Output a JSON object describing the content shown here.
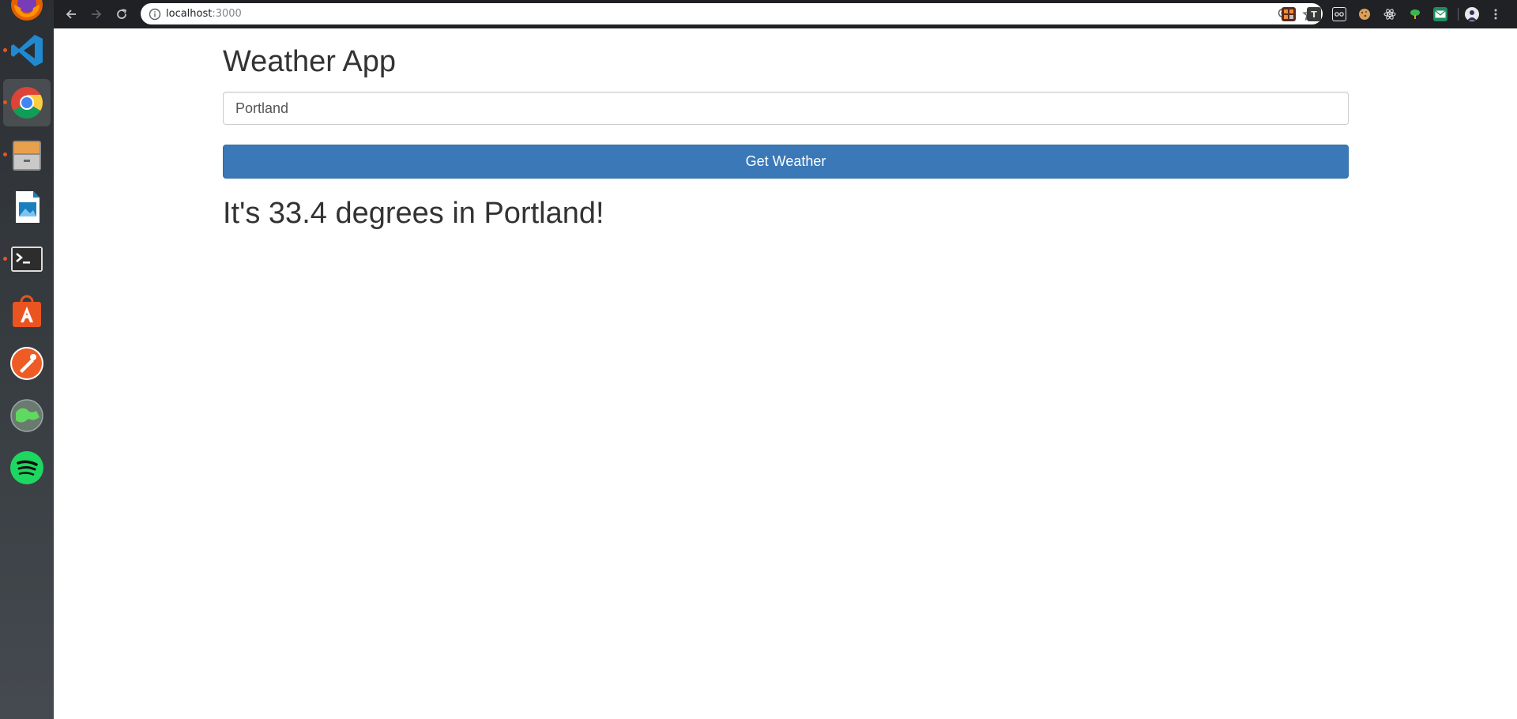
{
  "browser": {
    "url_host": "localhost",
    "url_port": ":3000"
  },
  "dock": {
    "apps": [
      {
        "name": "firefox-icon"
      },
      {
        "name": "vscode-icon"
      },
      {
        "name": "chrome-icon"
      },
      {
        "name": "file-cabinet-icon"
      },
      {
        "name": "image-viewer-icon"
      },
      {
        "name": "terminal-icon"
      },
      {
        "name": "software-center-icon"
      },
      {
        "name": "postman-icon"
      },
      {
        "name": "globe-icon"
      },
      {
        "name": "spotify-icon"
      }
    ],
    "accent": "#e95420"
  },
  "extensions": {
    "text_ext_label": "T"
  },
  "app": {
    "title": "Weather App",
    "city_value": "Portland",
    "button_label": "Get Weather",
    "result_text": "It's 33.4 degrees in Portland!",
    "button_color": "#3a78b7"
  }
}
